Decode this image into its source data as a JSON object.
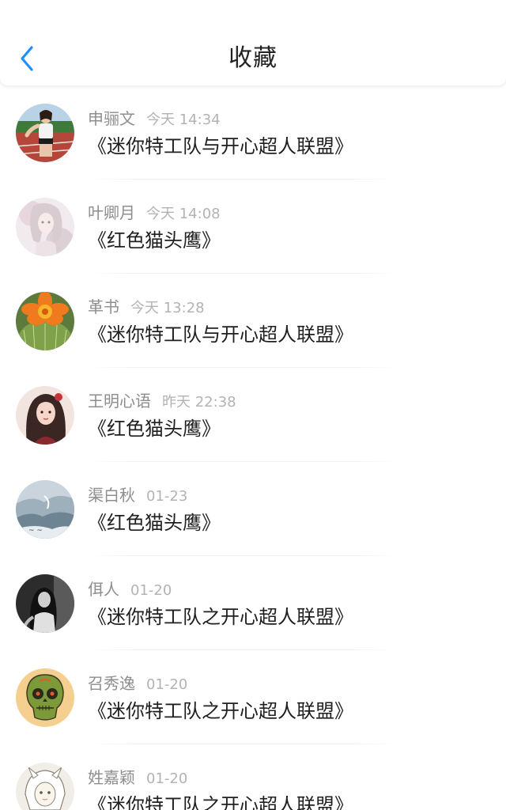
{
  "header": {
    "title": "收藏",
    "back_icon": "chevron-left-icon",
    "accent_color": "#1e90ff"
  },
  "items": [
    {
      "user": "申骊文",
      "time": "今天 14:34",
      "title": "《迷你特工队与开心超人联盟》",
      "avatar": "runner-photo"
    },
    {
      "user": "叶卿月",
      "time": "今天 14:08",
      "title": "《红色猫头鹰》",
      "avatar": "anime-girl-illustration"
    },
    {
      "user": "革书",
      "time": "今天 13:28",
      "title": "《迷你特工队与开心超人联盟》",
      "avatar": "cactus-flower-photo"
    },
    {
      "user": "王明心语",
      "time": "昨天 22:38",
      "title": "《红色猫头鹰》",
      "avatar": "girl-portrait-photo"
    },
    {
      "user": "渠白秋",
      "time": "01-23",
      "title": "《红色猫头鹰》",
      "avatar": "landscape-art"
    },
    {
      "user": "佴人",
      "time": "01-20",
      "title": "《迷你特工队之开心超人联盟》",
      "avatar": "black-white-girl-photo"
    },
    {
      "user": "召秀逸",
      "time": "01-20",
      "title": "《迷你特工队之开心超人联盟》",
      "avatar": "sugar-skull-illustration"
    },
    {
      "user": "姓嘉颖",
      "time": "01-20",
      "title": "《迷你特工队之开心超人联盟》",
      "avatar": "anime-sketch-illustration"
    }
  ]
}
